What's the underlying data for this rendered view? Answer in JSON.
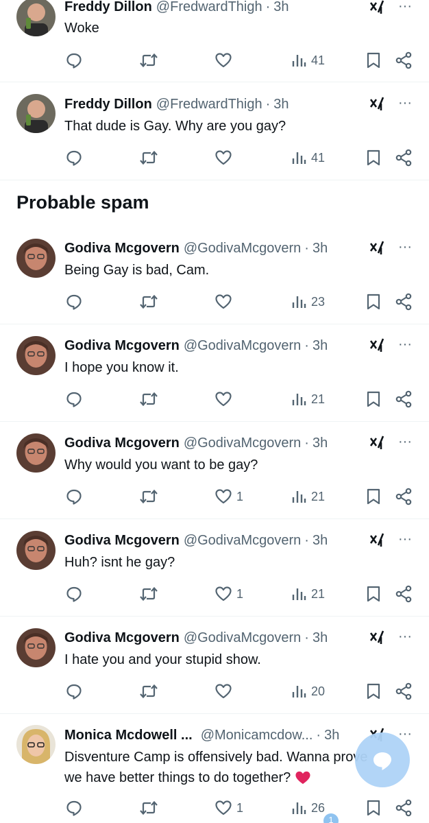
{
  "section": {
    "title": "Probable spam"
  },
  "tweets": [
    {
      "name": "Freddy Dillon",
      "handle": "@FredwardThigh",
      "time": "3h",
      "text": [
        "Woke"
      ],
      "likes": "",
      "views": "41"
    },
    {
      "name": "Freddy Dillon",
      "handle": "@FredwardThigh",
      "time": "3h",
      "text": [
        "That dude is Gay. Why are you gay?"
      ],
      "likes": "",
      "views": "41"
    },
    {
      "name": "Godiva Mcgovern",
      "handle": "@GodivaMcgovern",
      "time": "3h",
      "text": [
        "Being Gay is bad, Cam."
      ],
      "likes": "",
      "views": "23"
    },
    {
      "name": "Godiva Mcgovern",
      "handle": "@GodivaMcgovern",
      "time": "3h",
      "text": [
        "I hope you know it."
      ],
      "likes": "",
      "views": "21"
    },
    {
      "name": "Godiva Mcgovern",
      "handle": "@GodivaMcgovern",
      "time": "3h",
      "text": [
        "Why would you want to be gay?"
      ],
      "likes": "1",
      "views": "21"
    },
    {
      "name": "Godiva Mcgovern",
      "handle": "@GodivaMcgovern",
      "time": "3h",
      "text": [
        "Huh? isnt he gay?"
      ],
      "likes": "1",
      "views": "21"
    },
    {
      "name": "Godiva Mcgovern",
      "handle": "@GodivaMcgovern",
      "time": "3h",
      "text": [
        "I hate you and your stupid show."
      ],
      "likes": "",
      "views": "20"
    },
    {
      "name": "Monica Mcdowell ...",
      "handle": "@Monicamcdow...",
      "time": "3h",
      "text": [
        "Disventure Camp is offensively bad.  Wanna prove",
        "we have better things to do together?"
      ],
      "likes": "1",
      "views": "26"
    }
  ],
  "icons": {
    "reply": "reply-icon",
    "retweet": "retweet-icon",
    "like": "heart-icon",
    "views": "views-icon",
    "bookmark": "bookmark-icon",
    "share": "share-icon",
    "grok": "grok-icon",
    "more": "more-icon",
    "compose": "compose-icon"
  },
  "heart_emoji": "❤️",
  "notification_badge": "1",
  "colors": {
    "text": "#0f1419",
    "secondary": "#536471",
    "divider": "#eff3f4",
    "fab": "#aed3f7",
    "heart": "#e0245e"
  }
}
